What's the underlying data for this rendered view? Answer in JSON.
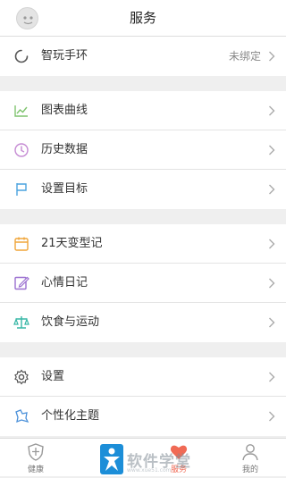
{
  "header": {
    "title": "服务"
  },
  "device_row": {
    "label": "智玩手环",
    "value": "未绑定"
  },
  "group1": {
    "items": [
      {
        "label": "图表曲线",
        "icon": "chart-line-icon"
      },
      {
        "label": "历史数据",
        "icon": "clock-icon"
      },
      {
        "label": "设置目标",
        "icon": "flag-icon"
      }
    ]
  },
  "group2": {
    "items": [
      {
        "label": "21天变型记",
        "icon": "calendar-icon"
      },
      {
        "label": "心情日记",
        "icon": "edit-note-icon"
      },
      {
        "label": "饮食与运动",
        "icon": "balance-scale-icon"
      }
    ]
  },
  "group3": {
    "items": [
      {
        "label": "设置",
        "icon": "gear-icon"
      },
      {
        "label": "个性化主题",
        "icon": "theme-icon"
      }
    ]
  },
  "tabbar": {
    "tabs": [
      {
        "label": "健康",
        "icon": "shield-icon"
      },
      {
        "label": "服务",
        "icon": "heart-icon"
      },
      {
        "label": "我的",
        "icon": "person-icon"
      }
    ]
  },
  "watermark": {
    "text": "软件学堂",
    "sub": "www.xue51.com"
  },
  "colors": {
    "accent": "#f06a55",
    "chart_icon": "#7fc46f",
    "clock_icon": "#c58ad3",
    "flag_icon": "#4aa3df",
    "calendar_icon": "#f0a63a",
    "edit_icon": "#9a6fd0",
    "scale_icon": "#37b7a6",
    "theme_icon": "#4a90d9"
  }
}
